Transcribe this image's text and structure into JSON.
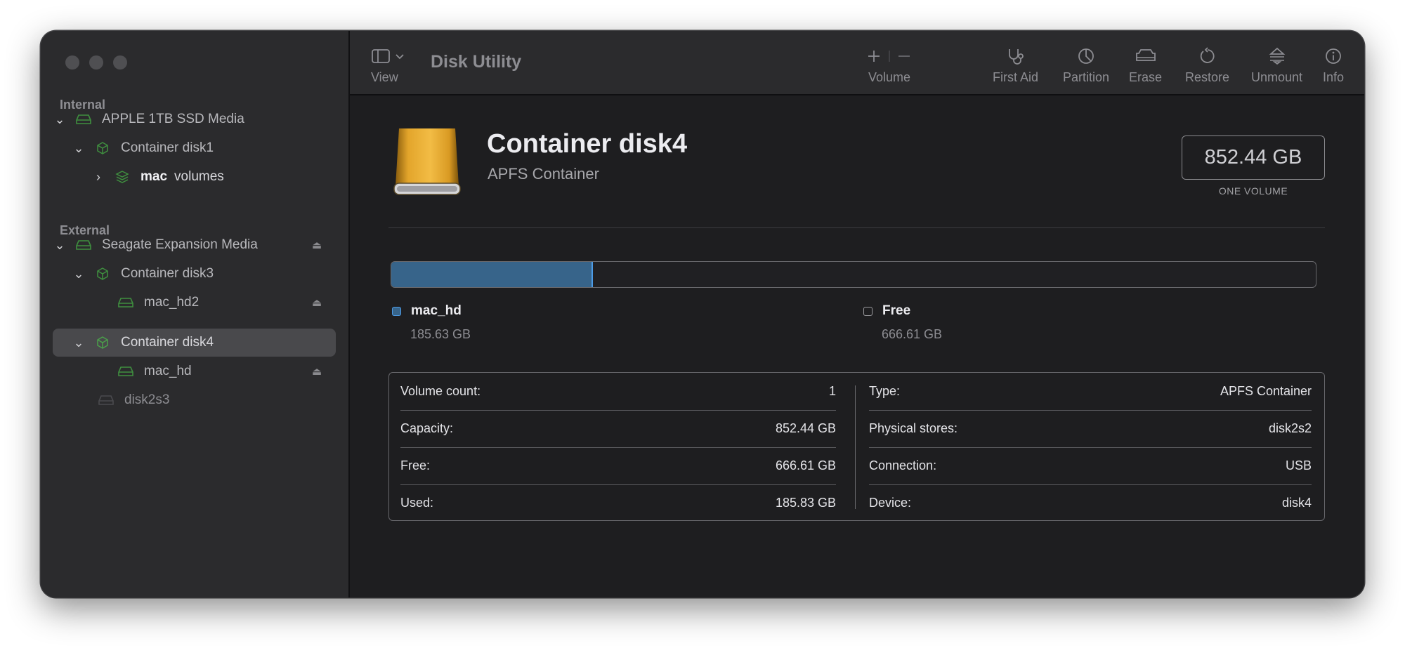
{
  "app": {
    "title": "Disk Utility"
  },
  "toolbar": {
    "view": "View",
    "volume": "Volume",
    "first_aid": "First Aid",
    "partition": "Partition",
    "erase": "Erase",
    "restore": "Restore",
    "unmount": "Unmount",
    "info": "Info"
  },
  "sidebar": {
    "internal_label": "Internal",
    "external_label": "External",
    "items": [
      {
        "label": "APPLE 1TB SSD Media"
      },
      {
        "label": "Container disk1"
      },
      {
        "label_bold": "mac",
        "label": "volumes"
      },
      {
        "label": "Seagate Expansion Media"
      },
      {
        "label": "Container disk3"
      },
      {
        "label": "mac_hd2"
      },
      {
        "label": "Container disk4"
      },
      {
        "label": "mac_hd"
      },
      {
        "label": "disk2s3"
      }
    ]
  },
  "header": {
    "name": "Container disk4",
    "subtitle": "APFS Container",
    "capacity": "852.44 GB",
    "capacity_label": "ONE VOLUME"
  },
  "usage": {
    "used_fraction": 0.218,
    "used_color": "#37648a",
    "segments": [
      {
        "name": "mac_hd",
        "size": "185.63 GB"
      },
      {
        "name": "Free",
        "size": "666.61 GB"
      }
    ]
  },
  "info": {
    "left": [
      {
        "label": "Volume count:",
        "value": "1"
      },
      {
        "label": "Capacity:",
        "value": "852.44 GB"
      },
      {
        "label": "Free:",
        "value": "666.61 GB"
      },
      {
        "label": "Used:",
        "value": "185.83 GB"
      }
    ],
    "right": [
      {
        "label": "Type:",
        "value": "APFS Container"
      },
      {
        "label": "Physical stores:",
        "value": "disk2s2"
      },
      {
        "label": "Connection:",
        "value": "USB"
      },
      {
        "label": "Device:",
        "value": "disk4"
      }
    ]
  },
  "icons": {
    "sidebar_toggle": "sidebar-icon",
    "volume_add": "plus-icon",
    "volume_remove": "minus-icon",
    "first_aid": "stethoscope-icon",
    "partition": "pie-icon",
    "erase": "car-icon",
    "restore": "restore-icon",
    "unmount": "unmount-icon",
    "info": "info-icon",
    "disk": "external-drive-icon"
  }
}
